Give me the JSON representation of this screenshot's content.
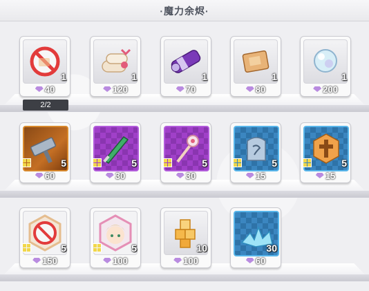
{
  "title": "·魔力余烬·",
  "shop": {
    "limit_label": "2/2",
    "rows": [
      [
        {
          "name": "no-entry-item",
          "qty": "1",
          "price": "40"
        },
        {
          "name": "scroll-bundle",
          "qty": "1",
          "price": "120"
        },
        {
          "name": "purple-scroll",
          "qty": "1",
          "price": "70"
        },
        {
          "name": "tome",
          "qty": "1",
          "price": "80"
        },
        {
          "name": "crystal-orb",
          "qty": "1",
          "price": "200"
        }
      ],
      [
        {
          "name": "bronze-hammer",
          "qty": "5",
          "price": "60"
        },
        {
          "name": "green-dagger",
          "qty": "5",
          "price": "30"
        },
        {
          "name": "flower-scepter",
          "qty": "5",
          "price": "30"
        },
        {
          "name": "rune-tablet",
          "qty": "5",
          "price": "15"
        },
        {
          "name": "cross-emblem",
          "qty": "5",
          "price": "15"
        }
      ],
      [
        {
          "name": "no-entry-hex",
          "qty": "5",
          "price": "150"
        },
        {
          "name": "character-portrait",
          "qty": "5",
          "price": "100"
        },
        {
          "name": "gold-blocks",
          "qty": "10",
          "price": "100"
        },
        {
          "name": "blue-crystal-shards",
          "qty": "30",
          "price": "60"
        }
      ]
    ]
  },
  "colors": {
    "gem": "#b98be0",
    "bronze": "#c46f24",
    "purple": "#a040c8",
    "blue": "#3b86c0",
    "cube": "#f1d74a"
  }
}
